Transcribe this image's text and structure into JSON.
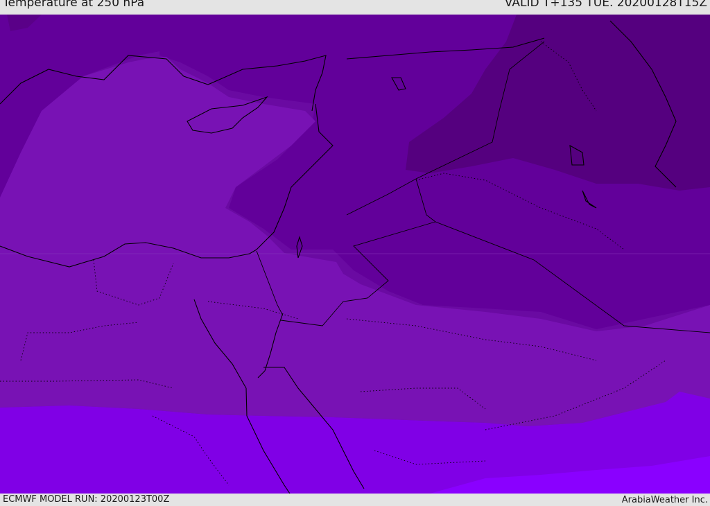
{
  "header": {
    "title": "Temperature at 250 hPa",
    "valid_time": "VALID T+135 TUE. 20200128T15Z"
  },
  "footer": {
    "model_run": "ECMWF MODEL RUN: 20200123T00Z",
    "credit": "ArabiaWeather Inc."
  },
  "colors": {
    "darkest": "#55007f",
    "dark": "#62009a",
    "mid_dark": "#6a0aa2",
    "mid": "#7812b4",
    "light": "#8000e6",
    "lightest": "#8a00ff",
    "borders": "#000000"
  }
}
